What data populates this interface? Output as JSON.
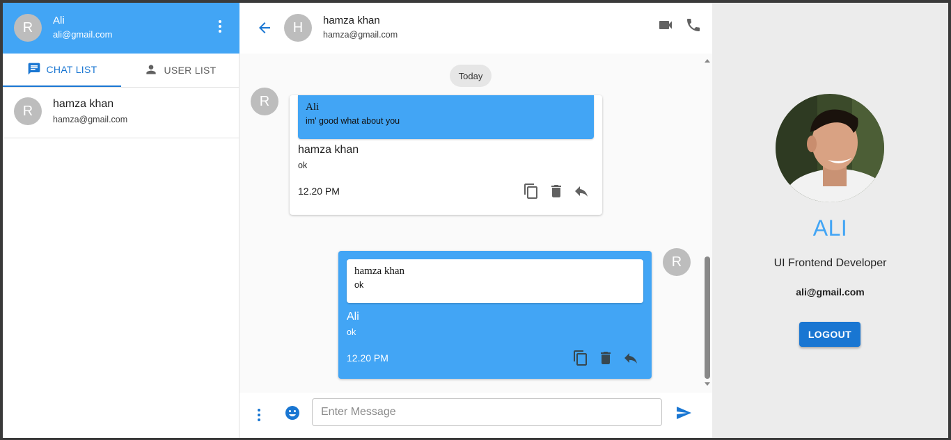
{
  "current_user": {
    "avatar_letter": "R",
    "name": "Ali",
    "email": "ali@gmail.com"
  },
  "tabs": [
    {
      "label": "CHAT LIST",
      "icon": "chat-icon",
      "active": true
    },
    {
      "label": "USER LIST",
      "icon": "person-icon",
      "active": false
    }
  ],
  "chat_list": [
    {
      "avatar_letter": "R",
      "name": "hamza khan",
      "email": "hamza@gmail.com"
    }
  ],
  "chat_header": {
    "avatar_letter": "H",
    "name": "hamza khan",
    "email": "hamza@gmail.com"
  },
  "date_chip": "Today",
  "messages": [
    {
      "avatar_letter": "R",
      "quoted": {
        "name": "Ali",
        "text": "im' good what about you"
      },
      "sender": "hamza khan",
      "text": "ok",
      "time": "12.20 PM",
      "actions": [
        "copy-icon",
        "delete-icon",
        "reply-icon"
      ]
    },
    {
      "avatar_letter": "R",
      "quoted": {
        "name": "hamza khan",
        "text": "ok"
      },
      "sender": "Ali",
      "text": "ok",
      "time": "12.20 PM",
      "actions": [
        "copy-icon",
        "delete-icon",
        "reply-icon"
      ]
    }
  ],
  "composer": {
    "placeholder": "Enter Message",
    "value": ""
  },
  "profile": {
    "name": "ALI",
    "role": "UI Frontend Developer",
    "email": "ali@gmail.com",
    "logout_label": "LOGOUT"
  },
  "colors": {
    "primary": "#42a5f5",
    "accent": "#1976d2",
    "panel_bg": "#ececec"
  }
}
